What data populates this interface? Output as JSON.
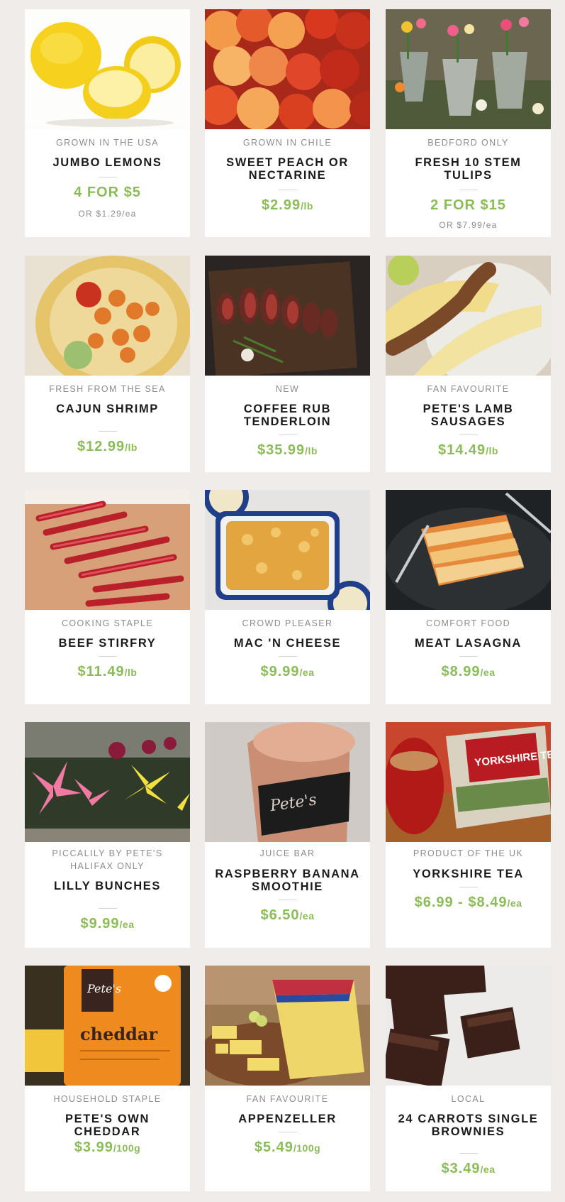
{
  "colors": {
    "background": "#efecea",
    "card": "#ffffff",
    "price": "#8cbb5a",
    "eyebrow": "#8c8c8c",
    "title": "#1a1a1a"
  },
  "products": [
    {
      "image": "lemons-photo",
      "eyebrow": "GROWN IN THE USA",
      "name": "JUMBO LEMONS",
      "price": "4 FOR $5",
      "unit": "",
      "alt_price": "OR $1.29/ea"
    },
    {
      "image": "peaches-photo",
      "eyebrow": "GROWN IN CHILE",
      "name": "SWEET PEACH OR NECTARINE",
      "price": "$2.99",
      "unit": "/lb"
    },
    {
      "image": "tulips-photo",
      "eyebrow": "BEDFORD ONLY",
      "name": "FRESH 10 STEM TULIPS",
      "price": "2 FOR $15",
      "unit": "",
      "alt_price": "OR $7.99/ea"
    },
    {
      "image": "shrimp-photo",
      "eyebrow": "FRESH FROM THE SEA",
      "name": "CAJUN SHRIMP",
      "price": "$12.99",
      "unit": "/lb"
    },
    {
      "image": "tenderloin-photo",
      "eyebrow": "NEW",
      "name": "COFFEE RUB TENDERLOIN",
      "price": "$35.99",
      "unit": "/lb"
    },
    {
      "image": "sausages-photo",
      "eyebrow": "FAN FAVOURITE",
      "name": "PETE'S LAMB SAUSAGES",
      "price": "$14.49",
      "unit": "/lb"
    },
    {
      "image": "stirfry-photo",
      "eyebrow": "COOKING STAPLE",
      "name": "BEEF STIRFRY",
      "price": "$11.49",
      "unit": "/lb"
    },
    {
      "image": "mac-cheese-photo",
      "eyebrow": "CROWD PLEASER",
      "name": "MAC 'N CHEESE",
      "price": "$9.99",
      "unit": "/ea"
    },
    {
      "image": "lasagna-photo",
      "eyebrow": "COMFORT FOOD",
      "name": "MEAT LASAGNA",
      "price": "$8.99",
      "unit": "/ea"
    },
    {
      "image": "lilies-photo",
      "eyebrow": "PICCALILY BY PETE'S HALIFAX ONLY",
      "name": "LILLY BUNCHES",
      "price": "$9.99",
      "unit": "/ea"
    },
    {
      "image": "smoothie-photo",
      "eyebrow": "JUICE BAR",
      "name": "RASPBERRY BANANA SMOOTHIE",
      "price": "$6.50",
      "unit": "/ea",
      "image_text": "Pete's"
    },
    {
      "image": "tea-photo",
      "eyebrow": "PRODUCT OF THE UK",
      "name": "YORKSHIRE TEA",
      "price": "$6.99 - $8.49",
      "unit": "/ea",
      "image_text": "YORKSHIRE TEA"
    },
    {
      "image": "cheddar-photo",
      "eyebrow": "HOUSEHOLD STAPLE",
      "name": "PETE'S OWN CHEDDAR",
      "price": "$3.99",
      "unit": "/100g",
      "image_text": "cheddar"
    },
    {
      "image": "appenzeller-photo",
      "eyebrow": "FAN FAVOURITE",
      "name": "APPENZELLER",
      "price": "$5.49",
      "unit": "/100g"
    },
    {
      "image": "brownies-photo",
      "eyebrow": "LOCAL",
      "name": "24 CARROTS SINGLE BROWNIES",
      "price": "$3.49",
      "unit": "/ea"
    }
  ]
}
